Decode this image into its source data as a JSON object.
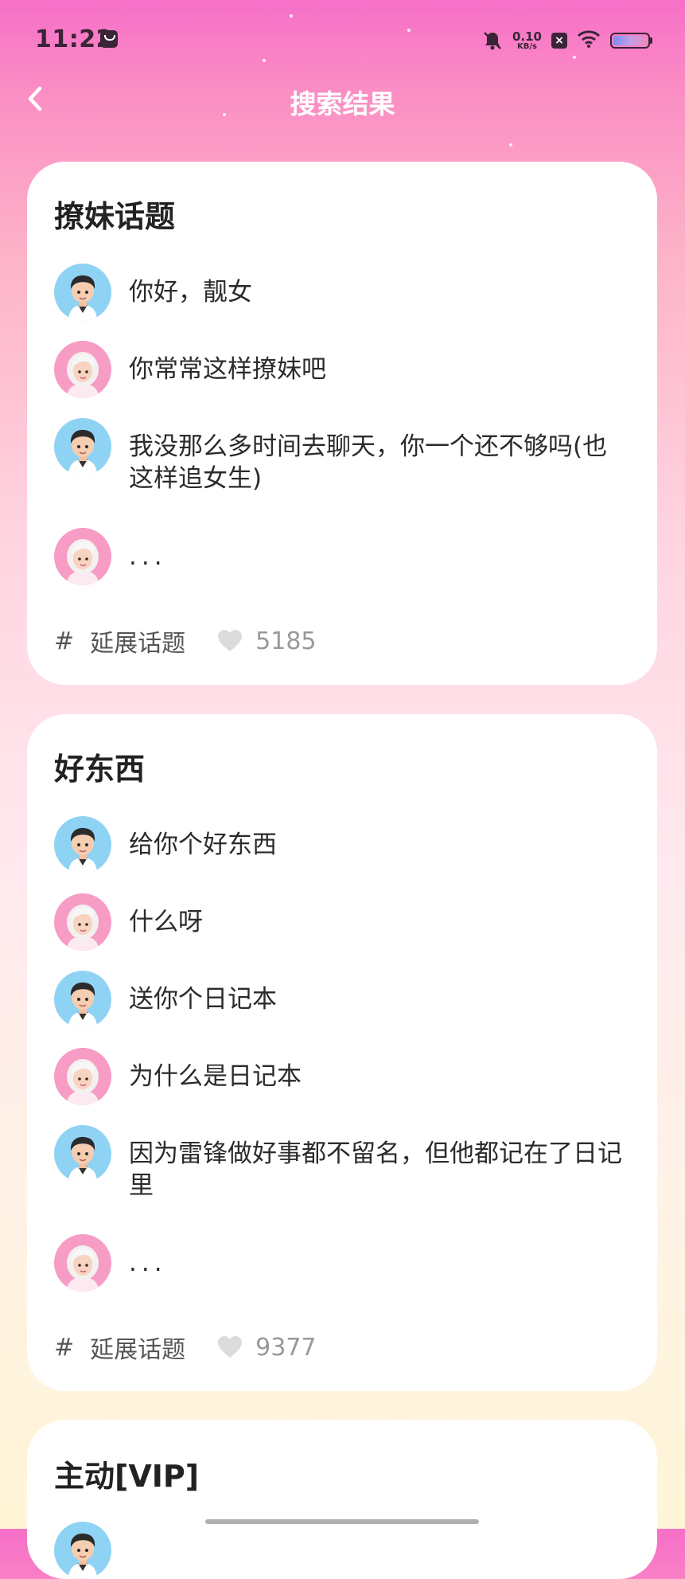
{
  "status_bar": {
    "time": "11:22",
    "net_speed_value": "0.10",
    "net_speed_unit": "KB/s"
  },
  "nav": {
    "title": "搜索结果",
    "back_icon": "chevron-left-icon"
  },
  "cards": [
    {
      "title": "撩妹话题",
      "messages": [
        {
          "speaker": "male",
          "text": "你好，靓女"
        },
        {
          "speaker": "female",
          "text": "你常常这样撩妹吧"
        },
        {
          "speaker": "male",
          "text": "我没那么多时间去聊天，你一个还不够吗(也这样追女生)"
        },
        {
          "speaker": "female",
          "text": "..."
        }
      ],
      "tag_symbol": "#",
      "tag_label": "延展话题",
      "likes": "5185"
    },
    {
      "title": "好东西",
      "messages": [
        {
          "speaker": "male",
          "text": "给你个好东西"
        },
        {
          "speaker": "female",
          "text": "什么呀"
        },
        {
          "speaker": "male",
          "text": "送你个日记本"
        },
        {
          "speaker": "female",
          "text": "为什么是日记本"
        },
        {
          "speaker": "male",
          "text": "因为雷锋做好事都不留名，但他都记在了日记里"
        },
        {
          "speaker": "female",
          "text": "..."
        }
      ],
      "tag_symbol": "#",
      "tag_label": "延展话题",
      "likes": "9377"
    },
    {
      "title": "主动[VIP]"
    }
  ],
  "colors": {
    "gradient_top": "#f66fc8",
    "gradient_bottom": "#fff5d6",
    "male_avatar_bg": "#8fd3f4",
    "female_avatar_bg": "#f79cc4"
  }
}
